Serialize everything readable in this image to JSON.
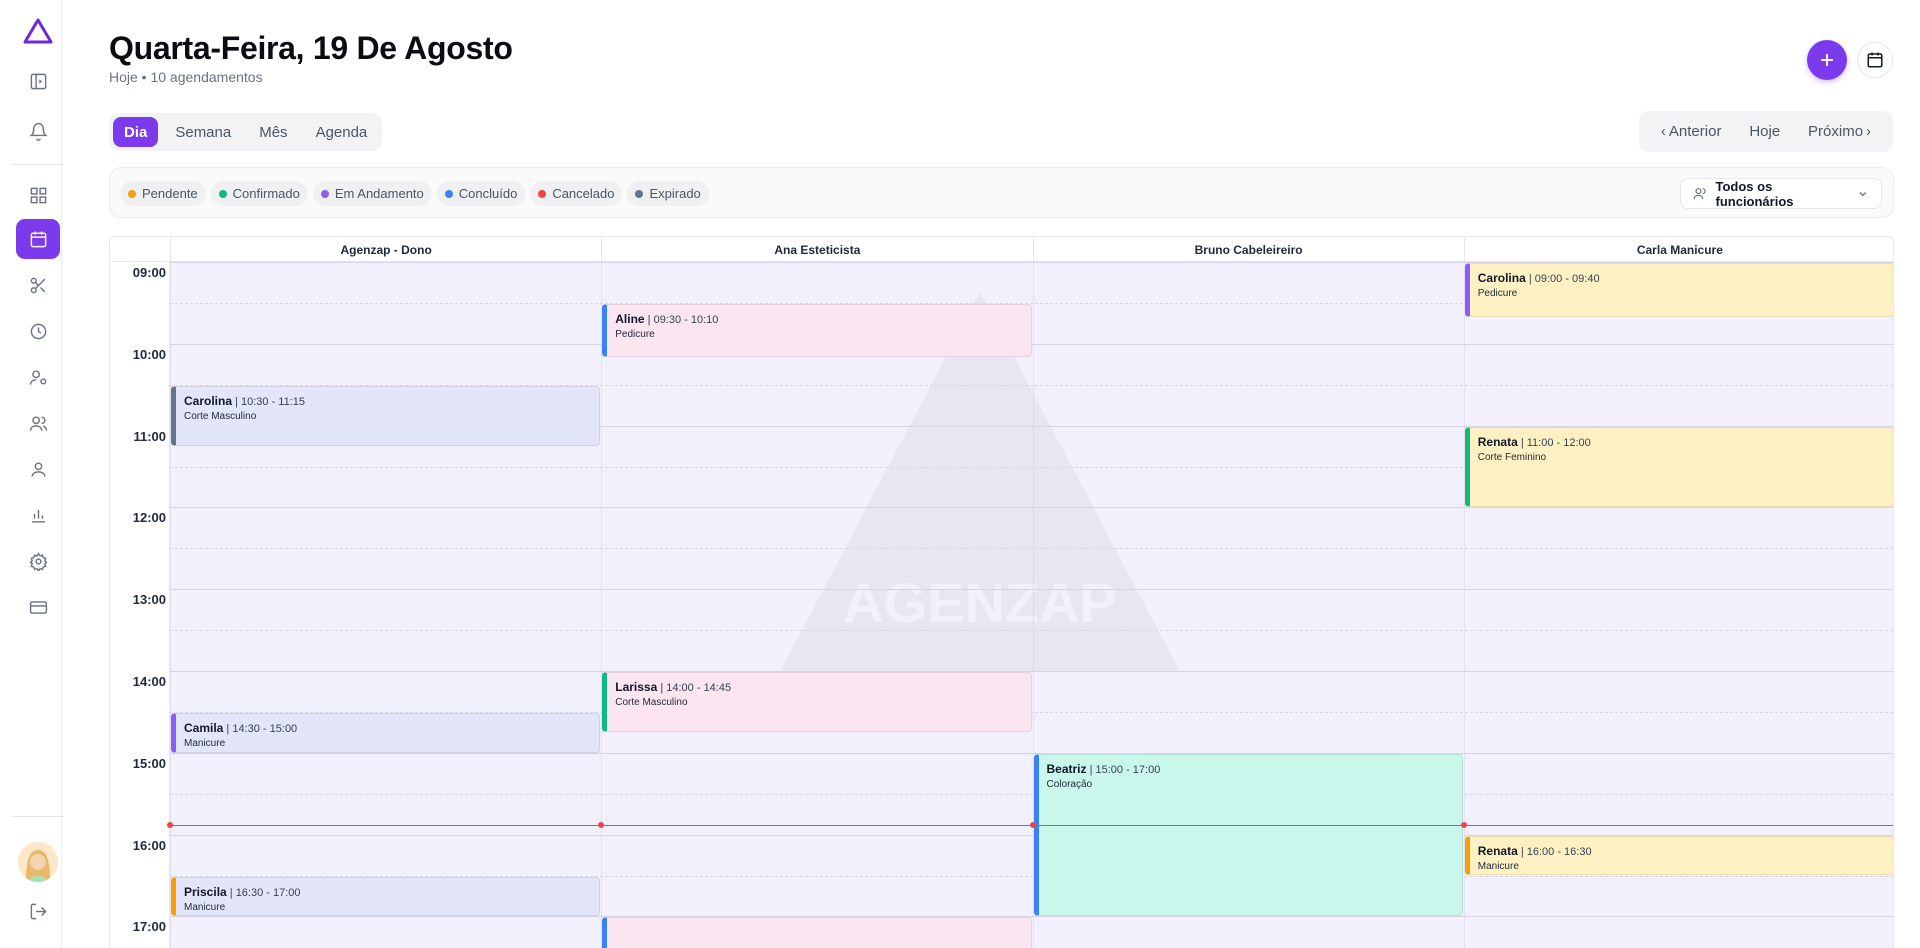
{
  "header": {
    "title": "Quarta-Feira, 19 De Agosto",
    "subtitle": "Hoje • 10 agendamentos"
  },
  "view_tabs": [
    "Dia",
    "Semana",
    "Mês",
    "Agenda"
  ],
  "active_view": "Dia",
  "nav": {
    "prev": "Anterior",
    "today": "Hoje",
    "next": "Próximo"
  },
  "legend": [
    {
      "label": "Pendente",
      "color": "#f59e0b"
    },
    {
      "label": "Confirmado",
      "color": "#10b981"
    },
    {
      "label": "Em Andamento",
      "color": "#8b5cf6"
    },
    {
      "label": "Concluído",
      "color": "#3b82f6"
    },
    {
      "label": "Cancelado",
      "color": "#ef4444"
    },
    {
      "label": "Expirado",
      "color": "#64748b"
    }
  ],
  "employee_filter": "Todos os funcionários",
  "staff": [
    "Agenzap - Dono",
    "Ana Esteticista",
    "Bruno Cabeleireiro",
    "Carla Manicure"
  ],
  "hours": [
    "09:00",
    "10:00",
    "11:00",
    "12:00",
    "13:00",
    "14:00",
    "15:00",
    "16:00",
    "17:00"
  ],
  "current_time": "15:53",
  "appointments": [
    {
      "staff": 0,
      "name": "Carolina",
      "time": "10:30 - 11:15",
      "service": "Corte Masculino",
      "start": "10:30",
      "end": "11:15",
      "status_color": "#64748b",
      "bg": "#e3e5f8"
    },
    {
      "staff": 0,
      "name": "Camila",
      "time": "14:30 - 15:00",
      "service": "Manicure",
      "start": "14:30",
      "end": "15:00",
      "status_color": "#8b5cf6",
      "bg": "#e3e5f8"
    },
    {
      "staff": 0,
      "name": "Priscila",
      "time": "16:30 - 17:00",
      "service": "Manicure",
      "start": "16:30",
      "end": "17:00",
      "status_color": "#f59e0b",
      "bg": "#e3e5f8"
    },
    {
      "staff": 1,
      "name": "Aline",
      "time": "09:30 - 10:10",
      "service": "Pedicure",
      "start": "09:30",
      "end": "10:10",
      "status_color": "#3b82f6",
      "bg": "#fbe5f1"
    },
    {
      "staff": 1,
      "name": "Larissa",
      "time": "14:00 - 14:45",
      "service": "Corte Masculino",
      "start": "14:00",
      "end": "14:45",
      "status_color": "#10b981",
      "bg": "#fbe5f1"
    },
    {
      "staff": 1,
      "name": "",
      "time": "",
      "service": "",
      "start": "17:00",
      "end": "17:30",
      "status_color": "#3b82f6",
      "bg": "#fbe5f1"
    },
    {
      "staff": 2,
      "name": "Beatriz",
      "time": "15:00 - 17:00",
      "service": "Coloração",
      "start": "15:00",
      "end": "17:00",
      "status_color": "#3b82f6",
      "bg": "#c9f7ec"
    },
    {
      "staff": 3,
      "name": "Carolina",
      "time": "09:00 - 09:40",
      "service": "Pedicure",
      "start": "09:00",
      "end": "09:40",
      "status_color": "#8b5cf6",
      "bg": "#fdf1c4"
    },
    {
      "staff": 3,
      "name": "Renata",
      "time": "11:00 - 12:00",
      "service": "Corte Feminino",
      "start": "11:00",
      "end": "12:00",
      "status_color": "#10b981",
      "bg": "#fdf1c4"
    },
    {
      "staff": 3,
      "name": "Renata",
      "time": "16:00 - 16:30",
      "service": "Manicure",
      "start": "16:00",
      "end": "16:30",
      "status_color": "#f59e0b",
      "bg": "#fdf1c4"
    }
  ],
  "watermark_text": "AGENZAP",
  "colors": {
    "accent": "#7c3aed",
    "now_line": "#ef4444"
  }
}
